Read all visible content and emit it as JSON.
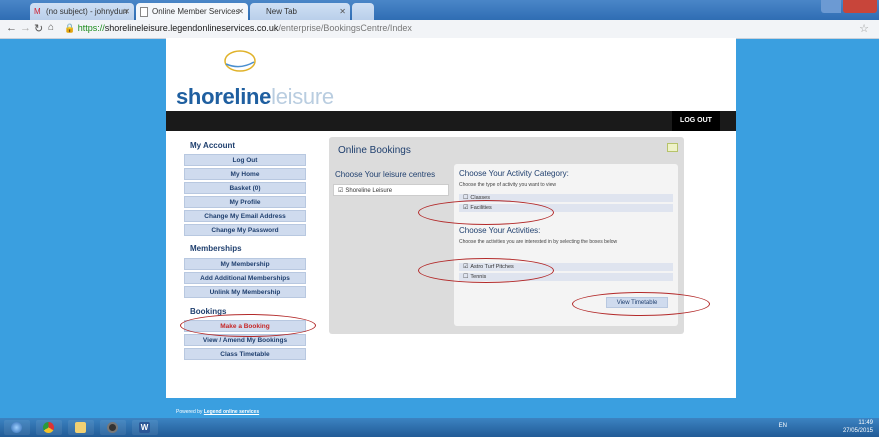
{
  "browser": {
    "tabs": [
      {
        "label": "(no subject) - johnydurr",
        "active": false
      },
      {
        "label": "Online Member Services",
        "active": true
      },
      {
        "label": "New Tab",
        "active": false
      }
    ],
    "url": {
      "scheme": "https://",
      "host": "shorelineleisure.legendonlineservices.co.uk",
      "path": "/enterprise/BookingsCentre/Index"
    },
    "icons": [
      "back-icon",
      "forward-icon",
      "reload-icon",
      "home-icon",
      "lock-icon",
      "star-icon"
    ]
  },
  "site": {
    "logo": {
      "primary": "shoreline",
      "secondary": "leisure"
    },
    "logout": "LOG OUT",
    "footer": {
      "prefix": "Powered by",
      "link": "Legend online services"
    }
  },
  "sidebar": {
    "my_account": {
      "heading": "My Account",
      "items": [
        "Log Out",
        "My Home",
        "Basket (0)",
        "My Profile",
        "Change My Email Address",
        "Change My Password"
      ]
    },
    "memberships": {
      "heading": "Memberships",
      "items": [
        "My Membership",
        "Add Additional Memberships",
        "Unlink My Membership"
      ]
    },
    "bookings": {
      "heading": "Bookings",
      "items": [
        "Make a Booking",
        "View / Amend My Bookings",
        "Class Timetable"
      ]
    }
  },
  "bookings_panel": {
    "title": "Online Bookings",
    "centres_heading": "Choose Your leisure centres",
    "centre": {
      "label": "Shoreline Leisure",
      "checked": true
    },
    "category": {
      "heading": "Choose Your Activity Category:",
      "hint": "Choose the type of activity you want to view",
      "options": [
        {
          "label": "Classes",
          "checked": false
        },
        {
          "label": "Facilities",
          "checked": true
        }
      ]
    },
    "activities": {
      "heading": "Choose Your Activities:",
      "hint": "Choose the activities you are interested in by selecting the boxes below",
      "options": [
        {
          "label": "Astro Turf Pitches",
          "checked": true
        },
        {
          "label": "Tennis",
          "checked": false
        }
      ]
    },
    "view_timetable": "View Timetable"
  },
  "taskbar": {
    "apps": [
      "start-orb-icon",
      "chrome-icon",
      "file-explorer-icon",
      "media-player-icon",
      "word-icon"
    ],
    "language": "EN",
    "time": "11:49",
    "date": "27/05/2015"
  },
  "colors": {
    "desktop": "#3a9fe0",
    "brand": "#1f5fa0",
    "highlight": "#c62828",
    "annotation": "#b32a2a"
  }
}
